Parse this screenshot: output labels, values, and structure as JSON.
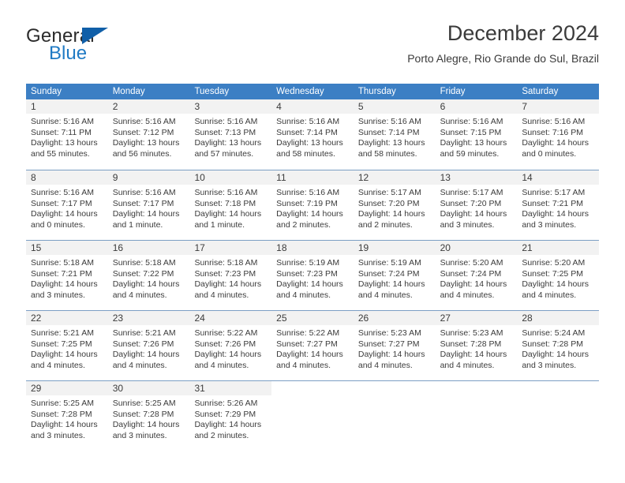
{
  "brand": {
    "name_part1": "General",
    "name_part2": "Blue"
  },
  "header": {
    "title": "December 2024",
    "subtitle": "Porto Alegre, Rio Grande do Sul, Brazil",
    "header_color": "#3c7fc4",
    "accent_color": "#105fa8"
  },
  "weekdays": [
    "Sunday",
    "Monday",
    "Tuesday",
    "Wednesday",
    "Thursday",
    "Friday",
    "Saturday"
  ],
  "weeks": [
    [
      {
        "day": "1",
        "sunrise": "Sunrise: 5:16 AM",
        "sunset": "Sunset: 7:11 PM",
        "daylight1": "Daylight: 13 hours",
        "daylight2": "and 55 minutes."
      },
      {
        "day": "2",
        "sunrise": "Sunrise: 5:16 AM",
        "sunset": "Sunset: 7:12 PM",
        "daylight1": "Daylight: 13 hours",
        "daylight2": "and 56 minutes."
      },
      {
        "day": "3",
        "sunrise": "Sunrise: 5:16 AM",
        "sunset": "Sunset: 7:13 PM",
        "daylight1": "Daylight: 13 hours",
        "daylight2": "and 57 minutes."
      },
      {
        "day": "4",
        "sunrise": "Sunrise: 5:16 AM",
        "sunset": "Sunset: 7:14 PM",
        "daylight1": "Daylight: 13 hours",
        "daylight2": "and 58 minutes."
      },
      {
        "day": "5",
        "sunrise": "Sunrise: 5:16 AM",
        "sunset": "Sunset: 7:14 PM",
        "daylight1": "Daylight: 13 hours",
        "daylight2": "and 58 minutes."
      },
      {
        "day": "6",
        "sunrise": "Sunrise: 5:16 AM",
        "sunset": "Sunset: 7:15 PM",
        "daylight1": "Daylight: 13 hours",
        "daylight2": "and 59 minutes."
      },
      {
        "day": "7",
        "sunrise": "Sunrise: 5:16 AM",
        "sunset": "Sunset: 7:16 PM",
        "daylight1": "Daylight: 14 hours",
        "daylight2": "and 0 minutes."
      }
    ],
    [
      {
        "day": "8",
        "sunrise": "Sunrise: 5:16 AM",
        "sunset": "Sunset: 7:17 PM",
        "daylight1": "Daylight: 14 hours",
        "daylight2": "and 0 minutes."
      },
      {
        "day": "9",
        "sunrise": "Sunrise: 5:16 AM",
        "sunset": "Sunset: 7:17 PM",
        "daylight1": "Daylight: 14 hours",
        "daylight2": "and 1 minute."
      },
      {
        "day": "10",
        "sunrise": "Sunrise: 5:16 AM",
        "sunset": "Sunset: 7:18 PM",
        "daylight1": "Daylight: 14 hours",
        "daylight2": "and 1 minute."
      },
      {
        "day": "11",
        "sunrise": "Sunrise: 5:16 AM",
        "sunset": "Sunset: 7:19 PM",
        "daylight1": "Daylight: 14 hours",
        "daylight2": "and 2 minutes."
      },
      {
        "day": "12",
        "sunrise": "Sunrise: 5:17 AM",
        "sunset": "Sunset: 7:20 PM",
        "daylight1": "Daylight: 14 hours",
        "daylight2": "and 2 minutes."
      },
      {
        "day": "13",
        "sunrise": "Sunrise: 5:17 AM",
        "sunset": "Sunset: 7:20 PM",
        "daylight1": "Daylight: 14 hours",
        "daylight2": "and 3 minutes."
      },
      {
        "day": "14",
        "sunrise": "Sunrise: 5:17 AM",
        "sunset": "Sunset: 7:21 PM",
        "daylight1": "Daylight: 14 hours",
        "daylight2": "and 3 minutes."
      }
    ],
    [
      {
        "day": "15",
        "sunrise": "Sunrise: 5:18 AM",
        "sunset": "Sunset: 7:21 PM",
        "daylight1": "Daylight: 14 hours",
        "daylight2": "and 3 minutes."
      },
      {
        "day": "16",
        "sunrise": "Sunrise: 5:18 AM",
        "sunset": "Sunset: 7:22 PM",
        "daylight1": "Daylight: 14 hours",
        "daylight2": "and 4 minutes."
      },
      {
        "day": "17",
        "sunrise": "Sunrise: 5:18 AM",
        "sunset": "Sunset: 7:23 PM",
        "daylight1": "Daylight: 14 hours",
        "daylight2": "and 4 minutes."
      },
      {
        "day": "18",
        "sunrise": "Sunrise: 5:19 AM",
        "sunset": "Sunset: 7:23 PM",
        "daylight1": "Daylight: 14 hours",
        "daylight2": "and 4 minutes."
      },
      {
        "day": "19",
        "sunrise": "Sunrise: 5:19 AM",
        "sunset": "Sunset: 7:24 PM",
        "daylight1": "Daylight: 14 hours",
        "daylight2": "and 4 minutes."
      },
      {
        "day": "20",
        "sunrise": "Sunrise: 5:20 AM",
        "sunset": "Sunset: 7:24 PM",
        "daylight1": "Daylight: 14 hours",
        "daylight2": "and 4 minutes."
      },
      {
        "day": "21",
        "sunrise": "Sunrise: 5:20 AM",
        "sunset": "Sunset: 7:25 PM",
        "daylight1": "Daylight: 14 hours",
        "daylight2": "and 4 minutes."
      }
    ],
    [
      {
        "day": "22",
        "sunrise": "Sunrise: 5:21 AM",
        "sunset": "Sunset: 7:25 PM",
        "daylight1": "Daylight: 14 hours",
        "daylight2": "and 4 minutes."
      },
      {
        "day": "23",
        "sunrise": "Sunrise: 5:21 AM",
        "sunset": "Sunset: 7:26 PM",
        "daylight1": "Daylight: 14 hours",
        "daylight2": "and 4 minutes."
      },
      {
        "day": "24",
        "sunrise": "Sunrise: 5:22 AM",
        "sunset": "Sunset: 7:26 PM",
        "daylight1": "Daylight: 14 hours",
        "daylight2": "and 4 minutes."
      },
      {
        "day": "25",
        "sunrise": "Sunrise: 5:22 AM",
        "sunset": "Sunset: 7:27 PM",
        "daylight1": "Daylight: 14 hours",
        "daylight2": "and 4 minutes."
      },
      {
        "day": "26",
        "sunrise": "Sunrise: 5:23 AM",
        "sunset": "Sunset: 7:27 PM",
        "daylight1": "Daylight: 14 hours",
        "daylight2": "and 4 minutes."
      },
      {
        "day": "27",
        "sunrise": "Sunrise: 5:23 AM",
        "sunset": "Sunset: 7:28 PM",
        "daylight1": "Daylight: 14 hours",
        "daylight2": "and 4 minutes."
      },
      {
        "day": "28",
        "sunrise": "Sunrise: 5:24 AM",
        "sunset": "Sunset: 7:28 PM",
        "daylight1": "Daylight: 14 hours",
        "daylight2": "and 3 minutes."
      }
    ],
    [
      {
        "day": "29",
        "sunrise": "Sunrise: 5:25 AM",
        "sunset": "Sunset: 7:28 PM",
        "daylight1": "Daylight: 14 hours",
        "daylight2": "and 3 minutes."
      },
      {
        "day": "30",
        "sunrise": "Sunrise: 5:25 AM",
        "sunset": "Sunset: 7:28 PM",
        "daylight1": "Daylight: 14 hours",
        "daylight2": "and 3 minutes."
      },
      {
        "day": "31",
        "sunrise": "Sunrise: 5:26 AM",
        "sunset": "Sunset: 7:29 PM",
        "daylight1": "Daylight: 14 hours",
        "daylight2": "and 2 minutes."
      },
      {
        "day": "",
        "sunrise": "",
        "sunset": "",
        "daylight1": "",
        "daylight2": ""
      },
      {
        "day": "",
        "sunrise": "",
        "sunset": "",
        "daylight1": "",
        "daylight2": ""
      },
      {
        "day": "",
        "sunrise": "",
        "sunset": "",
        "daylight1": "",
        "daylight2": ""
      },
      {
        "day": "",
        "sunrise": "",
        "sunset": "",
        "daylight1": "",
        "daylight2": ""
      }
    ]
  ]
}
